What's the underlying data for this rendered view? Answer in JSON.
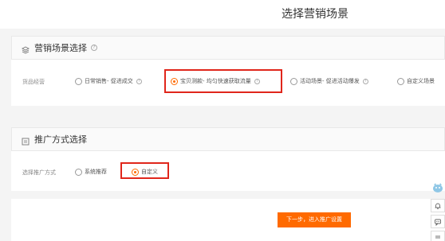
{
  "page": {
    "title": "选择营销场景"
  },
  "scene": {
    "section_title": "营销场景选择",
    "help_mark": "?",
    "row_label": "货品经营",
    "options": [
      {
        "label": "日常销售- 促进成交",
        "selected": false
      },
      {
        "label": "宝贝测款- 均匀快速获取流量",
        "selected": true
      },
      {
        "label": "活动场景- 促进活动爆发",
        "selected": false
      },
      {
        "label": "自定义场景",
        "selected": false
      }
    ]
  },
  "promo": {
    "section_title": "推广方式选择",
    "row_label": "选择推广方式",
    "options": [
      {
        "label": "系统推荐",
        "selected": false
      },
      {
        "label": "自定义",
        "selected": true
      }
    ]
  },
  "footer": {
    "next_label": "下一步，进入推广设置"
  },
  "sidebar": {
    "tools": [
      "bell-icon",
      "chat-icon",
      "menu-icon"
    ]
  },
  "colors": {
    "accent": "#ff6a00",
    "highlight": "#e0261b"
  }
}
